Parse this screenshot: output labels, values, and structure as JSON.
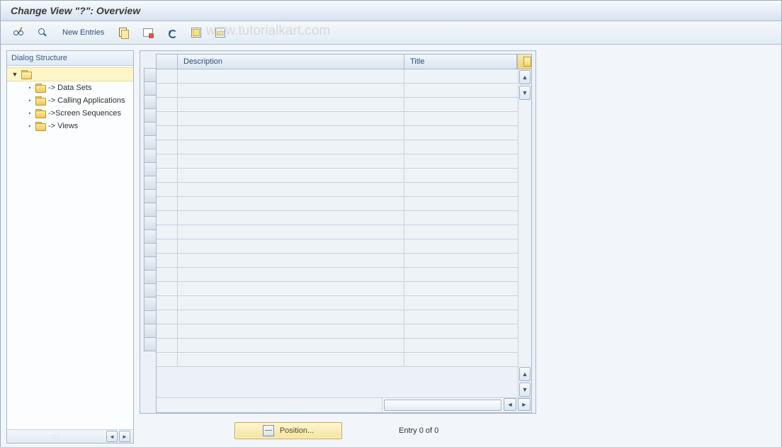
{
  "title": "Change View \"?\": Overview",
  "toolbar": {
    "new_entries_label": "New Entries"
  },
  "watermark": "www.tutorialkart.com",
  "tree": {
    "header": "Dialog Structure",
    "root_label": "",
    "items": [
      {
        "label": "-> Data Sets"
      },
      {
        "label": "-> Calling Applications"
      },
      {
        "label": "->Screen Sequences"
      },
      {
        "label": "-> Views"
      }
    ]
  },
  "table": {
    "columns": {
      "description": "Description",
      "title": "Title"
    },
    "row_count": 21
  },
  "footer": {
    "position_label": "Position...",
    "entry_status": "Entry 0 of 0"
  }
}
